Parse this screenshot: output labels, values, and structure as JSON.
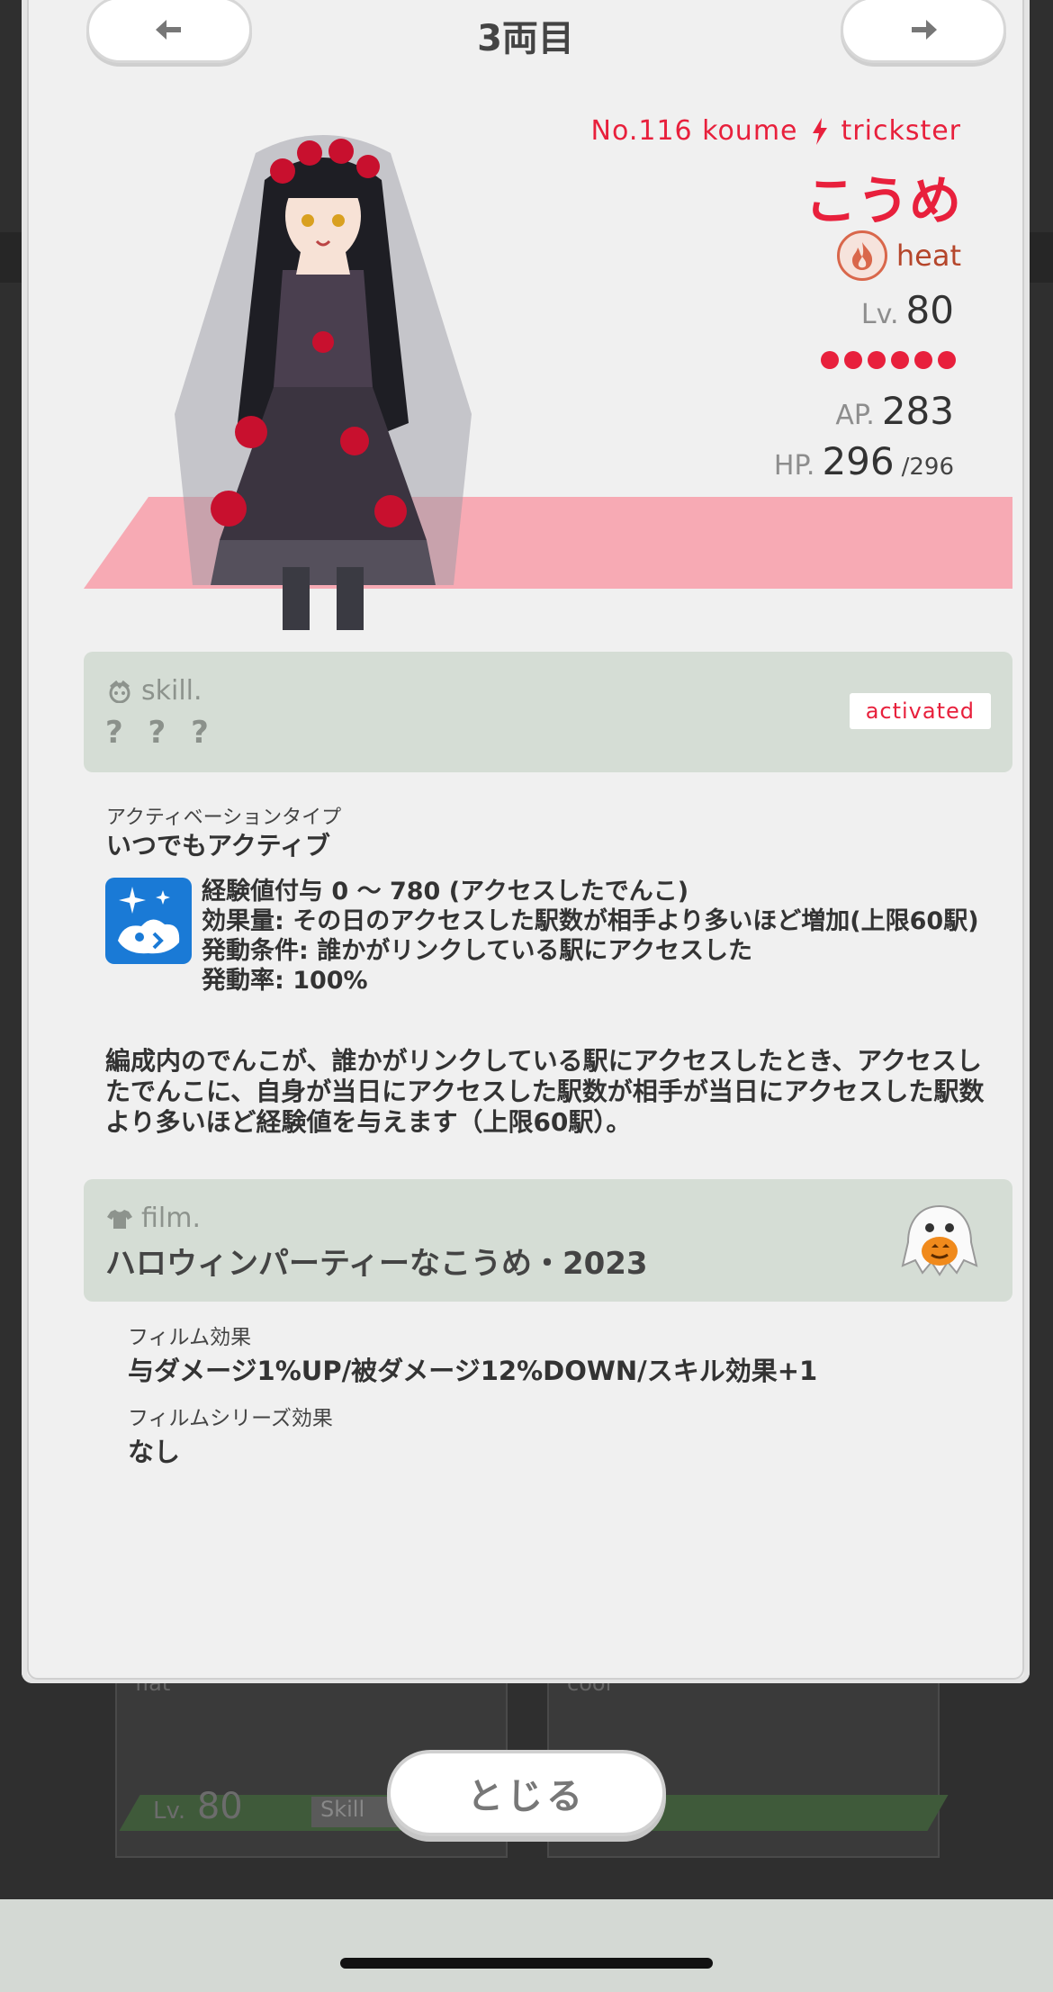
{
  "header": {
    "car_title": "3両目"
  },
  "character": {
    "id_text": "No.116 koume",
    "type": "trickster",
    "name": "こうめ",
    "attribute": "heat",
    "lv_label": "Lv.",
    "level": "80",
    "rank_dots": 6,
    "ap_label": "AP.",
    "ap": "283",
    "hp_label": "HP.",
    "hp": "296",
    "hp_max": "/296",
    "colors": {
      "accent": "#e8203c",
      "stripe": "#f7aab4",
      "attribute": "#b5462b"
    }
  },
  "skill": {
    "heading": "skill.",
    "name": "? ? ?",
    "badge": "activated",
    "activation_type_label": "アクティベーションタイプ",
    "activation_type": "いつでもアクティブ",
    "lines": [
      "経験値付与 0 〜 780 (アクセスしたでんこ)",
      "効果量: その日のアクセスした駅数が相手より多いほど増加(上限60駅)",
      "発動条件: 誰かがリンクしている駅にアクセスした",
      "発動率: 100%"
    ],
    "description": "編成内のでんこが、誰かがリンクしている駅にアクセスしたとき、アクセスしたでんこに、自身が当日にアクセスした駅数が相手が当日にアクセスした駅数より多いほど経験値を与えます（上限60駅）。"
  },
  "film": {
    "heading": "film.",
    "name": "ハロウィンパーティーなこうめ・2023",
    "effect_label": "フィルム効果",
    "effect": "与ダメージ1%UP/被ダメージ12%DOWN/スキル効果+1",
    "series_label": "フィルムシリーズ効果",
    "series_effect": "なし"
  },
  "background": {
    "card1_attr": "flat",
    "card1_lv_label": "Lv.",
    "card1_level": "80",
    "card1_skill": "Skill",
    "card2_attr": "cool"
  },
  "footer": {
    "close_label": "とじる"
  }
}
